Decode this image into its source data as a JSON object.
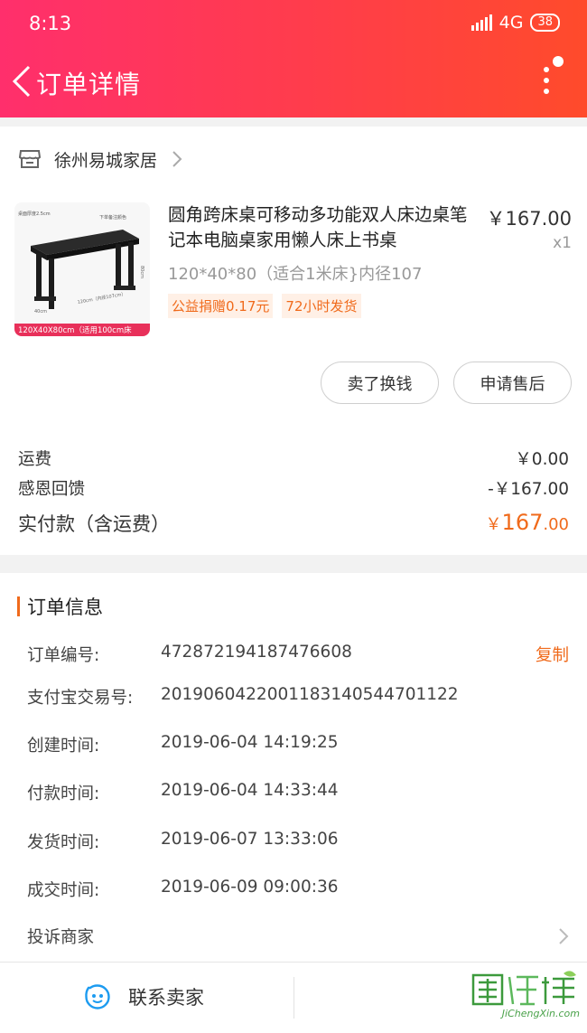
{
  "status_bar": {
    "time": "8:13",
    "network": "4G",
    "battery": "38"
  },
  "nav": {
    "title": "订单详情"
  },
  "shop": {
    "name": "徐州易城家居"
  },
  "product": {
    "title": "圆角跨床桌可移动多功能双人床边桌笔记本电脑桌家用懒人床上书桌",
    "spec": "120*40*80（适合1米床}内径107",
    "tags": [
      "公益捐赠0.17元",
      "72小时发货"
    ],
    "price": "￥167.00",
    "qty": "x1",
    "image_caption": "120X40X80cm（适用100cm床",
    "image_labels": {
      "top_left": "桌面厚度2.5cm",
      "top_right": "下单备注颜色",
      "dim": "120cm（内径107cm）",
      "depth": "40cm",
      "height": "80cm"
    }
  },
  "actions": {
    "sell_label": "卖了换钱",
    "after_sale_label": "申请售后"
  },
  "fees": [
    {
      "label": "运费",
      "value": "￥0.00"
    },
    {
      "label": "感恩回馈",
      "value": "-￥167.00"
    }
  ],
  "total": {
    "label": "实付款（含运费）",
    "currency": "￥",
    "integer": "167",
    "decimal": ".00"
  },
  "order_info": {
    "title": "订单信息",
    "copy_label": "复制",
    "rows": [
      {
        "label": "订单编号:",
        "value": "472872194187476608"
      },
      {
        "label": "支付宝交易号:",
        "value": "2019060422001183140544701122"
      },
      {
        "label": "创建时间:",
        "value": "2019-06-04 14:19:25"
      },
      {
        "label": "付款时间:",
        "value": "2019-06-04 14:33:44"
      },
      {
        "label": "发货时间:",
        "value": "2019-06-07 13:33:06"
      },
      {
        "label": "成交时间:",
        "value": "2019-06-09 09:00:36"
      }
    ],
    "complain_label": "投诉商家"
  },
  "bottom": {
    "contact_label": "联系卖家",
    "watermark_text": "JiChengXin.com"
  },
  "colors": {
    "accent": "#f06a1b",
    "header_start": "#ff2f6c",
    "header_end": "#ff4b2b"
  }
}
